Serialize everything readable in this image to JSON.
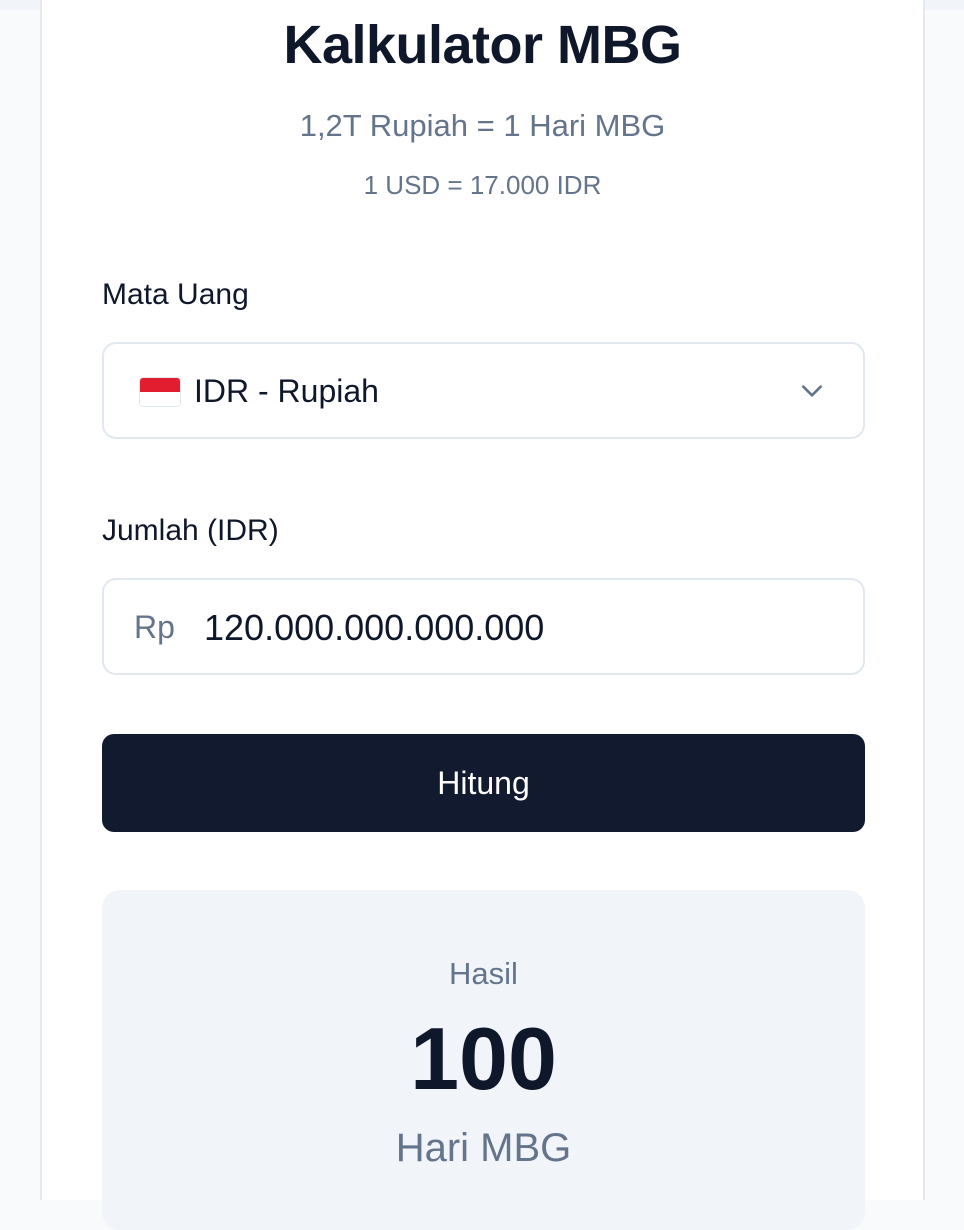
{
  "header": {
    "title": "Kalkulator MBG",
    "subtitle": "1,2T Rupiah = 1 Hari MBG",
    "rate": "1 USD = 17.000 IDR"
  },
  "currency": {
    "label": "Mata Uang",
    "selected": "IDR - Rupiah",
    "flag_icon": "indonesia-flag-icon"
  },
  "amount": {
    "label": "Jumlah (IDR)",
    "prefix": "Rp",
    "value": "120.000.000.000.000"
  },
  "action": {
    "label": "Hitung"
  },
  "result": {
    "label": "Hasil",
    "value": "100",
    "unit": "Hari MBG"
  },
  "colors": {
    "primary_button": "#111a2e",
    "text": "#0f172a",
    "muted": "#64748b",
    "result_bg": "#f1f5f9"
  }
}
